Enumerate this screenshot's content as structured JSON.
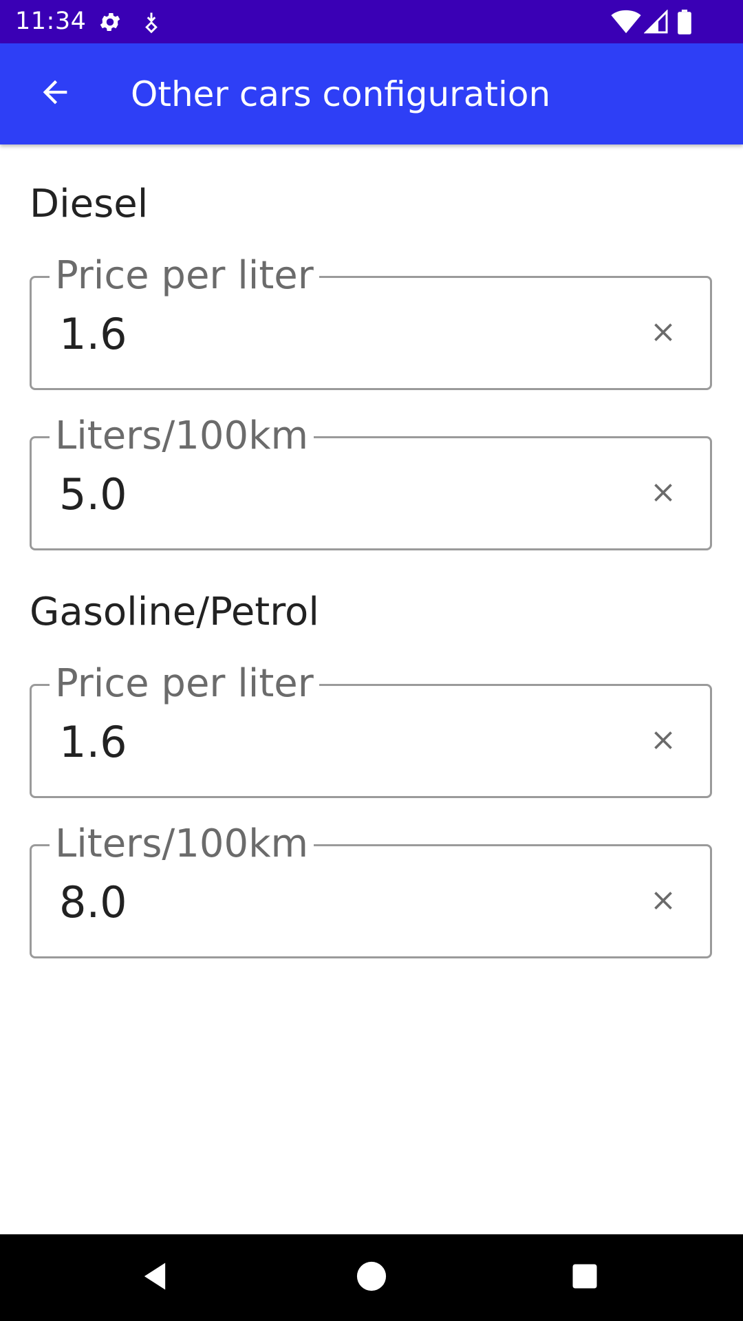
{
  "status_bar": {
    "time": "11:34",
    "left_icons": [
      "gear-icon",
      "download-badge-icon"
    ],
    "right_icons": [
      "wifi-icon",
      "cell-signal-icon",
      "battery-icon"
    ]
  },
  "app_bar": {
    "title": "Other cars configuration",
    "back_icon": "arrow-back-icon",
    "color": "#2e3ff6"
  },
  "sections": [
    {
      "title": "Diesel",
      "fields": [
        {
          "label": "Price per liter",
          "value": "1.6"
        },
        {
          "label": "Liters/100km",
          "value": "5.0"
        }
      ]
    },
    {
      "title": "Gasoline/Petrol",
      "fields": [
        {
          "label": "Price per liter",
          "value": "1.6"
        },
        {
          "label": "Liters/100km",
          "value": "8.0"
        }
      ]
    }
  ],
  "nav_bar": {
    "buttons": [
      "back-triangle-icon",
      "home-circle-icon",
      "recents-square-icon"
    ]
  }
}
